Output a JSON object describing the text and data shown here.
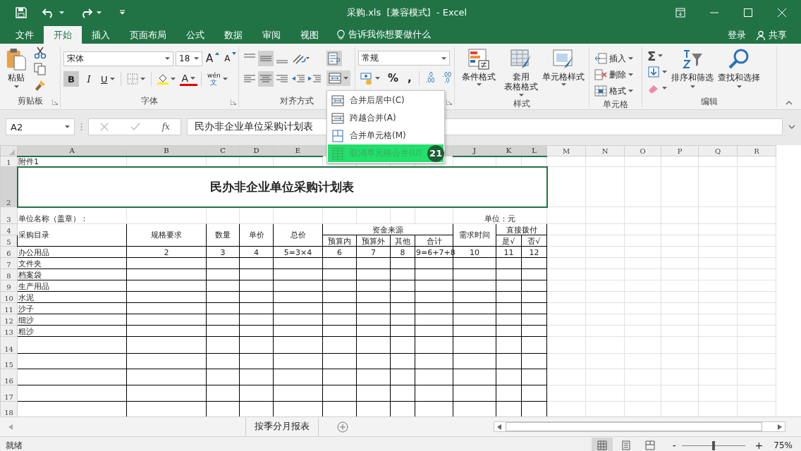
{
  "window": {
    "title": "采购.xls  [兼容模式]  - Excel"
  },
  "menu_tabs": [
    {
      "label": "文件",
      "selected": false
    },
    {
      "label": "开始",
      "selected": true
    },
    {
      "label": "插入",
      "selected": false
    },
    {
      "label": "页面布局",
      "selected": false
    },
    {
      "label": "公式",
      "selected": false
    },
    {
      "label": "数据",
      "selected": false
    },
    {
      "label": "审阅",
      "selected": false
    },
    {
      "label": "视图",
      "selected": false
    }
  ],
  "tell_me": "告诉我你想要做什么",
  "account": {
    "sign_in": "登录",
    "share": "共享"
  },
  "ribbon": {
    "clipboard": {
      "paste": "粘贴",
      "label": "剪贴板"
    },
    "font": {
      "name": "宋体",
      "size": "18",
      "grow": "A",
      "shrink": "A",
      "bold": "B",
      "italic": "I",
      "underline": "U",
      "font_color": "A",
      "phonetic_top": "wén",
      "phonetic_bottom": "文",
      "label": "字体"
    },
    "alignment": {
      "label": "对齐方式"
    },
    "number": {
      "format": "常规",
      "percent": "%",
      "comma": ",",
      "increase_decimal": [
        ".0",
        ".00"
      ],
      "decrease_decimal": [
        ".00",
        ".0"
      ]
    },
    "styles": {
      "items": [
        {
          "lines": [
            "条件格式"
          ]
        },
        {
          "lines": [
            "套用",
            "表格格式"
          ]
        },
        {
          "lines": [
            "单元格样式"
          ]
        }
      ],
      "label": "样式"
    },
    "cells": {
      "items": [
        "插入",
        "删除",
        "格式"
      ],
      "label": "单元格"
    },
    "editing": {
      "sum": "Σ",
      "items": [
        "排序和筛选",
        "查找和选择"
      ],
      "label": "编辑"
    }
  },
  "merge_menu": {
    "items": [
      {
        "label": "合并后居中(C)",
        "disabled": false,
        "selected": false
      },
      {
        "label": "跨越合并(A)",
        "disabled": false,
        "selected": false
      },
      {
        "label": "合并单元格(M)",
        "disabled": false,
        "selected": false
      },
      {
        "label": "取消单元格合并(U)",
        "disabled": true,
        "selected": true
      }
    ],
    "step_badge": "21"
  },
  "formula_bar": {
    "name_box": "A2",
    "fx": "fx",
    "formula": "民办非企业单位采购计划表"
  },
  "sheet": {
    "columns_left": [
      {
        "label": "A",
        "selected": true
      },
      {
        "label": "B",
        "selected": true
      },
      {
        "label": "C",
        "selected": true
      },
      {
        "label": "D",
        "selected": true
      },
      {
        "label": "E",
        "selected": true
      }
    ],
    "columns_right": [
      {
        "label": "J",
        "selected": true
      },
      {
        "label": "K",
        "selected": true
      },
      {
        "label": "L",
        "selected": true
      },
      {
        "label": "M",
        "selected": false
      },
      {
        "label": "N",
        "selected": false
      },
      {
        "label": "O",
        "selected": false
      },
      {
        "label": "P",
        "selected": false
      },
      {
        "label": "Q",
        "selected": false
      },
      {
        "label": "R",
        "selected": false
      }
    ],
    "rows": [
      {
        "number": "1",
        "selected": false,
        "cells": {
          "A": "附件1"
        }
      },
      {
        "number": "2",
        "selected": true,
        "cells": {
          "A": "民办非企业单位采购计划表"
        }
      },
      {
        "number": "3",
        "selected": false,
        "cells": {
          "A": "单位名称（盖章）：",
          "J": "单位：元"
        }
      },
      {
        "number": "4",
        "selected": false,
        "cells": {
          "A": "采购目录",
          "B": "规格要求",
          "C": "数量",
          "D": "单价",
          "E": "总价",
          "F": "资金来源",
          "J": "需求时间",
          "K": "直接拨付"
        }
      },
      {
        "number": "5",
        "selected": false,
        "cells": {
          "F": "预算内",
          "G": "预算外",
          "H": "其他",
          "I": "合计",
          "K": "是√",
          "L": "否√"
        }
      },
      {
        "number": "6",
        "selected": false,
        "cells": {
          "A": "办公用品",
          "B": "2",
          "C": "3",
          "D": "4",
          "E": "5=3×4",
          "F": "6",
          "G": "7",
          "H": "8",
          "I": "9=6+7+8",
          "J": "10",
          "K": "11",
          "L": "12"
        }
      },
      {
        "number": "7",
        "selected": false,
        "cells": {
          "A": "文件夹"
        }
      },
      {
        "number": "8",
        "selected": false,
        "cells": {
          "A": "档案袋"
        }
      },
      {
        "number": "9",
        "selected": false,
        "cells": {
          "A": "生产用品"
        }
      },
      {
        "number": "10",
        "selected": false,
        "cells": {
          "A": "水泥"
        }
      },
      {
        "number": "11",
        "selected": false,
        "cells": {
          "A": "沙子"
        }
      },
      {
        "number": "12",
        "selected": false,
        "cells": {
          "A": "细沙"
        }
      },
      {
        "number": "13",
        "selected": false,
        "cells": {
          "A": "粗沙"
        }
      },
      {
        "number": "14",
        "selected": false,
        "cells": {}
      },
      {
        "number": "15",
        "selected": false,
        "cells": {}
      },
      {
        "number": "16",
        "selected": false,
        "cells": {}
      },
      {
        "number": "17",
        "selected": false,
        "cells": {}
      },
      {
        "number": "18",
        "selected": false,
        "cells": {}
      }
    ]
  },
  "sheet_tabs": [
    {
      "label": "按季分月报表",
      "selected": false
    }
  ],
  "status_bar": {
    "status": "就绪",
    "views": [
      {
        "kind": "normal",
        "selected": true
      },
      {
        "kind": "page_layout",
        "selected": false
      },
      {
        "kind": "page_break",
        "selected": false
      }
    ],
    "zoom": {
      "level": 0.5,
      "minus": "-",
      "plus": "+",
      "reading": "75%"
    }
  }
}
